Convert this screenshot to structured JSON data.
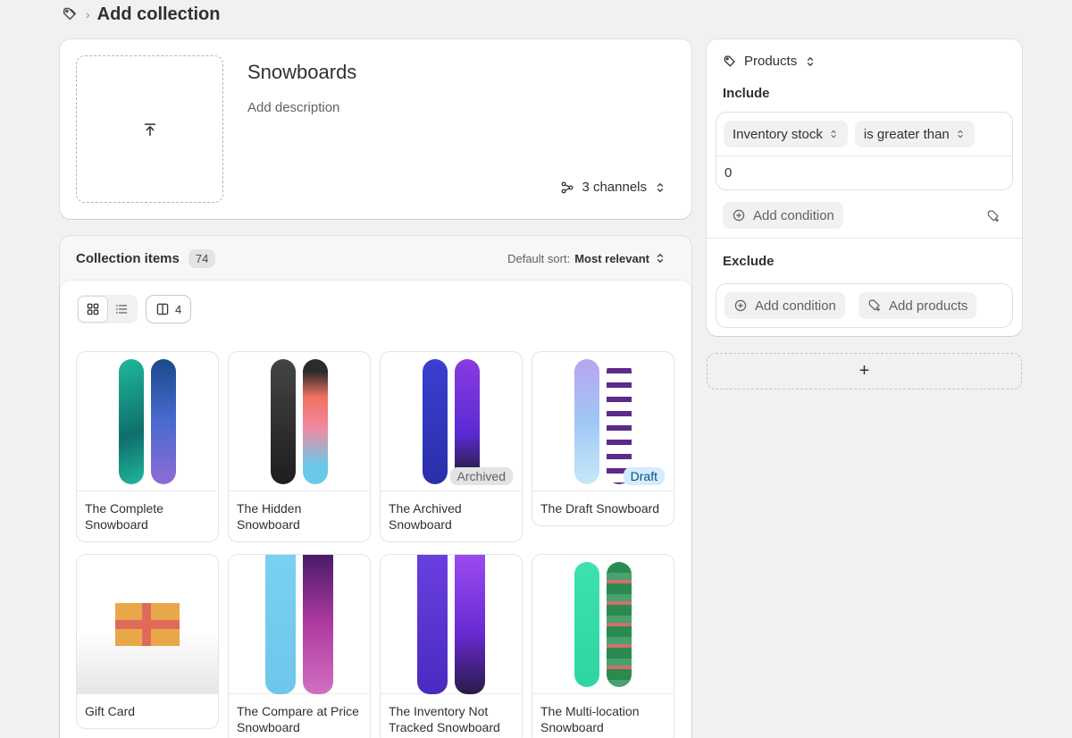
{
  "breadcrumb": {
    "icon": "collection-tag-icon",
    "title": "Add collection"
  },
  "collection": {
    "name": "Snowboards",
    "description_placeholder": "Add description",
    "channels": "3 channels"
  },
  "items": {
    "title": "Collection items",
    "count": "74",
    "sort_label": "Default sort:",
    "sort_value": "Most relevant",
    "columns": "4",
    "products": [
      {
        "name": "The Complete Snowboard",
        "badge": "",
        "colors": [
          "#1fb89c",
          "#8e6bd6"
        ]
      },
      {
        "name": "The Hidden Snowboard",
        "badge": "",
        "colors": [
          "#2b2b2b",
          "#f07060"
        ]
      },
      {
        "name": "The Archived Snowboard",
        "badge": "Archived",
        "colors": [
          "#3a3fd1",
          "#6a2bd4"
        ]
      },
      {
        "name": "The Draft Snowboard",
        "badge": "Draft",
        "colors": [
          "#9fc8f5",
          "#5b2a8a"
        ]
      },
      {
        "name": "Gift Card",
        "badge": "",
        "colors": []
      },
      {
        "name": "The Compare at Price Snowboard",
        "badge": "",
        "colors": [
          "#6ec6ec",
          "#b03ba0"
        ]
      },
      {
        "name": "The Inventory Not Tracked Snowboard",
        "badge": "",
        "colors": [
          "#5b2fd6",
          "#7a3be0"
        ]
      },
      {
        "name": "The Multi-location Snowboard",
        "badge": "",
        "colors": [
          "#2ed6a0",
          "#2a8a50"
        ]
      }
    ]
  },
  "conditions": {
    "type": "Products",
    "include_label": "Include",
    "field": "Inventory stock",
    "operator": "is greater than",
    "value": "0",
    "add_condition": "Add condition",
    "exclude_label": "Exclude",
    "add_products": "Add products"
  },
  "colors": {
    "archived_bg": "#e3e3e3",
    "draft_bg": "#d5ebff",
    "draft_text": "#00527c"
  }
}
